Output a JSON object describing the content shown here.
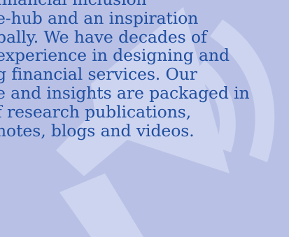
{
  "background": {
    "color": "#b8c1e5",
    "graphic_color": "#cdd4ef",
    "icon": "megaphone-icon"
  },
  "content": {
    "text_color": "#1f4ea0",
    "lines": [
      "financial inclusion",
      "e-hub and an inspiration",
      "bally. We have decades of",
      "experience in designing and",
      "g financial services. Our",
      "e and insights are packaged in",
      "f research publications,",
      "notes, blogs and videos."
    ]
  }
}
